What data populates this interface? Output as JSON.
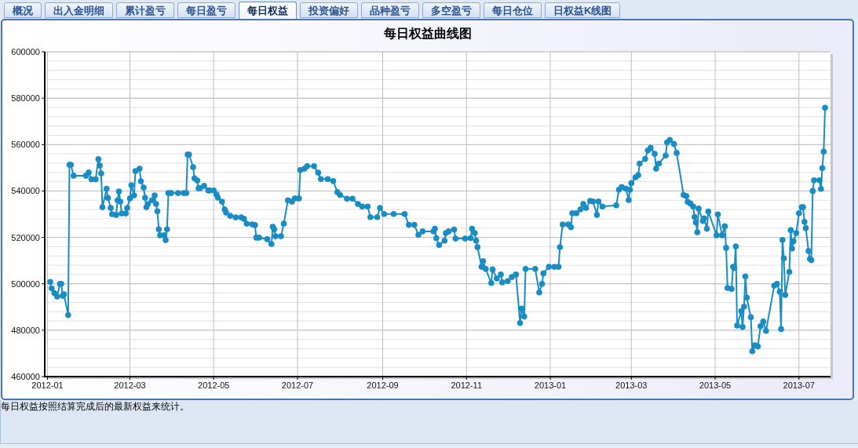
{
  "tabs": [
    {
      "label": "概况",
      "selected": false
    },
    {
      "label": "出入金明细",
      "selected": false
    },
    {
      "label": "累计盈亏",
      "selected": false
    },
    {
      "label": "每日盈亏",
      "selected": false
    },
    {
      "label": "每日权益",
      "selected": true
    },
    {
      "label": "投资偏好",
      "selected": false
    },
    {
      "label": "品种盈亏",
      "selected": false
    },
    {
      "label": "多空盈亏",
      "selected": false
    },
    {
      "label": "每日仓位",
      "selected": false
    },
    {
      "label": "日权益K线图",
      "selected": false
    }
  ],
  "panel": {
    "chart_data": {
      "type": "line",
      "title": "每日权益曲线图",
      "grid": true,
      "marker": "circle",
      "x": [
        "2012-01-03",
        "2012-01-04",
        "2012-01-06",
        "2012-01-08",
        "2012-01-10",
        "2012-01-11",
        "2012-01-12",
        "2012-01-13",
        "2012-01-16",
        "2012-01-17",
        "2012-01-18",
        "2012-01-20",
        "2012-01-29",
        "2012-01-31",
        "2012-02-02",
        "2012-02-05",
        "2012-02-07",
        "2012-02-08",
        "2012-02-09",
        "2012-02-10",
        "2012-02-13",
        "2012-02-14",
        "2012-02-16",
        "2012-02-17",
        "2012-02-20",
        "2012-02-21",
        "2012-02-22",
        "2012-02-23",
        "2012-02-24",
        "2012-02-27",
        "2012-02-28",
        "2012-03-01",
        "2012-03-02",
        "2012-03-04",
        "2012-03-05",
        "2012-03-08",
        "2012-03-09",
        "2012-03-11",
        "2012-03-12",
        "2012-03-13",
        "2012-03-14",
        "2012-03-17",
        "2012-03-19",
        "2012-03-20",
        "2012-03-21",
        "2012-03-22",
        "2012-03-23",
        "2012-03-26",
        "2012-03-27",
        "2012-03-28",
        "2012-03-29",
        "2012-03-31",
        "2012-04-05",
        "2012-04-09",
        "2012-04-11",
        "2012-04-12",
        "2012-04-13",
        "2012-04-16",
        "2012-04-17",
        "2012-04-19",
        "2012-04-20",
        "2012-04-21",
        "2012-04-24",
        "2012-04-27",
        "2012-04-28",
        "2012-05-01",
        "2012-05-03",
        "2012-05-04",
        "2012-05-07",
        "2012-05-09",
        "2012-05-10",
        "2012-05-13",
        "2012-05-17",
        "2012-05-21",
        "2012-05-23",
        "2012-05-25",
        "2012-05-29",
        "2012-05-31",
        "2012-06-01",
        "2012-06-03",
        "2012-06-09",
        "2012-06-12",
        "2012-06-13",
        "2012-06-14",
        "2012-06-15",
        "2012-06-19",
        "2012-06-21",
        "2012-06-24",
        "2012-06-27",
        "2012-06-29",
        "2012-07-02",
        "2012-07-03",
        "2012-07-06",
        "2012-07-08",
        "2012-07-13",
        "2012-07-16",
        "2012-07-18",
        "2012-07-23",
        "2012-07-27",
        "2012-07-30",
        "2012-08-01",
        "2012-08-06",
        "2012-08-10",
        "2012-08-14",
        "2012-08-17",
        "2012-08-21",
        "2012-08-23",
        "2012-08-28",
        "2012-08-30",
        "2012-09-02",
        "2012-09-09",
        "2012-09-17",
        "2012-09-20",
        "2012-09-24",
        "2012-09-27",
        "2012-09-30",
        "2012-10-08",
        "2012-10-09",
        "2012-10-10",
        "2012-10-12",
        "2012-10-16",
        "2012-10-17",
        "2012-10-19",
        "2012-10-23",
        "2012-10-24",
        "2012-10-31",
        "2012-11-04",
        "2012-11-05",
        "2012-11-07",
        "2012-11-08",
        "2012-11-09",
        "2012-11-12",
        "2012-11-13",
        "2012-11-15",
        "2012-11-19",
        "2012-11-20",
        "2012-11-23",
        "2012-11-26",
        "2012-11-27",
        "2012-12-01",
        "2012-12-04",
        "2012-12-07",
        "2012-12-10",
        "2012-12-11",
        "2012-12-13",
        "2012-12-14",
        "2012-12-21",
        "2012-12-24",
        "2012-12-26",
        "2012-12-27",
        "2012-12-31",
        "2013-01-04",
        "2013-01-07",
        "2013-01-08",
        "2013-01-10",
        "2013-01-14",
        "2013-01-16",
        "2013-01-17",
        "2013-01-20",
        "2013-01-23",
        "2013-01-25",
        "2013-01-27",
        "2013-01-30",
        "2013-02-01",
        "2013-02-04",
        "2013-02-05",
        "2013-02-08",
        "2013-02-18",
        "2013-02-20",
        "2013-02-22",
        "2013-02-25",
        "2013-02-27",
        "2013-02-28",
        "2013-03-01",
        "2013-03-04",
        "2013-03-06",
        "2013-03-07",
        "2013-03-11",
        "2013-03-13",
        "2013-03-15",
        "2013-03-18",
        "2013-03-19",
        "2013-03-21",
        "2013-03-26",
        "2013-03-27",
        "2013-03-29",
        "2013-04-01",
        "2013-04-03",
        "2013-04-08",
        "2013-04-10",
        "2013-04-11",
        "2013-04-13",
        "2013-04-15",
        "2013-04-16",
        "2013-04-17",
        "2013-04-18",
        "2013-04-19",
        "2013-04-22",
        "2013-04-23",
        "2013-04-25",
        "2013-04-26",
        "2013-05-02",
        "2013-05-03",
        "2013-05-06",
        "2013-05-08",
        "2013-05-09",
        "2013-05-10",
        "2013-05-13",
        "2013-05-14",
        "2013-05-15",
        "2013-05-16",
        "2013-05-17",
        "2013-05-20",
        "2013-05-21",
        "2013-05-22",
        "2013-05-23",
        "2013-05-24",
        "2013-05-27",
        "2013-05-28",
        "2013-05-30",
        "2013-06-01",
        "2013-06-03",
        "2013-06-05",
        "2013-06-07",
        "2013-06-13",
        "2013-06-15",
        "2013-06-17",
        "2013-06-18",
        "2013-06-19",
        "2013-06-20",
        "2013-06-21",
        "2013-06-24",
        "2013-06-25",
        "2013-06-26",
        "2013-06-27",
        "2013-06-29",
        "2013-07-01",
        "2013-07-03",
        "2013-07-04",
        "2013-07-05",
        "2013-07-06",
        "2013-07-08",
        "2013-07-09",
        "2013-07-10",
        "2013-07-11",
        "2013-07-12",
        "2013-07-16",
        "2013-07-17",
        "2013-07-18",
        "2013-07-19",
        "2013-07-20"
      ],
      "values": [
        500800,
        498000,
        496000,
        494500,
        500000,
        500000,
        494800,
        495500,
        486500,
        551300,
        551300,
        546600,
        546600,
        548000,
        545000,
        545000,
        553700,
        551000,
        547600,
        533000,
        541000,
        537000,
        532700,
        530000,
        529700,
        536000,
        539800,
        535400,
        530300,
        530300,
        532700,
        536800,
        542500,
        538100,
        548600,
        549600,
        544200,
        541500,
        537100,
        533000,
        534400,
        536000,
        538100,
        534400,
        531300,
        523500,
        520900,
        520900,
        518800,
        523500,
        539100,
        539100,
        539100,
        539100,
        539100,
        555700,
        555700,
        550300,
        545500,
        544500,
        541200,
        541200,
        542200,
        540200,
        540200,
        540200,
        538500,
        537100,
        535400,
        532000,
        530700,
        529300,
        528600,
        528600,
        528000,
        525900,
        525600,
        525300,
        519900,
        519900,
        519200,
        517100,
        524600,
        523500,
        520500,
        520500,
        525900,
        536000,
        535400,
        536800,
        536800,
        549000,
        549600,
        550700,
        550700,
        547900,
        545100,
        545100,
        544300,
        539500,
        538300,
        536700,
        536700,
        534400,
        533300,
        533300,
        528700,
        528700,
        532700,
        530100,
        530100,
        530100,
        525400,
        525400,
        521100,
        522600,
        522600,
        523700,
        519700,
        516700,
        518600,
        521900,
        522600,
        523400,
        519500,
        519500,
        519700,
        523700,
        521900,
        518600,
        515800,
        507300,
        509800,
        506400,
        500300,
        506200,
        502300,
        504000,
        500600,
        501200,
        502900,
        504000,
        483100,
        489300,
        485900,
        506400,
        506400,
        496300,
        500000,
        504500,
        507300,
        507300,
        507300,
        515800,
        525600,
        525600,
        524400,
        530400,
        530400,
        532100,
        534400,
        532700,
        535700,
        535500,
        529700,
        535500,
        533300,
        533800,
        540600,
        541700,
        541000,
        536100,
        540600,
        543400,
        545900,
        546800,
        551800,
        553800,
        557500,
        558600,
        556000,
        549600,
        551800,
        555300,
        560900,
        562000,
        560300,
        556400,
        538300,
        537800,
        535300,
        534600,
        533300,
        528800,
        526500,
        522200,
        532400,
        527100,
        528200,
        523700,
        531200,
        520900,
        529900,
        520900,
        524800,
        515500,
        498200,
        497800,
        507300,
        506800,
        516100,
        482000,
        488200,
        481400,
        490200,
        503200,
        494100,
        485600,
        470900,
        473500,
        473000,
        481700,
        483700,
        479700,
        499200,
        500000,
        496600,
        480500,
        518900,
        511000,
        495200,
        505100,
        523100,
        515200,
        518300,
        521900,
        530400,
        533000,
        533000,
        526700,
        524000,
        514100,
        510700,
        510200,
        540000,
        544600,
        544600,
        540900,
        549900,
        557000,
        575900
      ],
      "xlim": [
        "2011-12-30",
        "2013-07-24"
      ],
      "ylim": [
        460000,
        600000
      ],
      "xticks": [
        {
          "value": "2012-01-01",
          "label": "2012-01"
        },
        {
          "value": "2012-03-01",
          "label": "2012-03"
        },
        {
          "value": "2012-05-01",
          "label": "2012-05"
        },
        {
          "value": "2012-07-01",
          "label": "2012-07"
        },
        {
          "value": "2012-09-01",
          "label": "2012-09"
        },
        {
          "value": "2012-11-01",
          "label": "2012-11"
        },
        {
          "value": "2013-01-01",
          "label": "2013-01"
        },
        {
          "value": "2013-03-01",
          "label": "2013-03"
        },
        {
          "value": "2013-05-01",
          "label": "2013-05"
        },
        {
          "value": "2013-07-01",
          "label": "2013-07"
        }
      ],
      "yticks": [
        460000,
        480000,
        500000,
        520000,
        540000,
        560000,
        580000,
        600000
      ]
    }
  },
  "note": "每日权益按照结算完成后的最新权益来统计。"
}
